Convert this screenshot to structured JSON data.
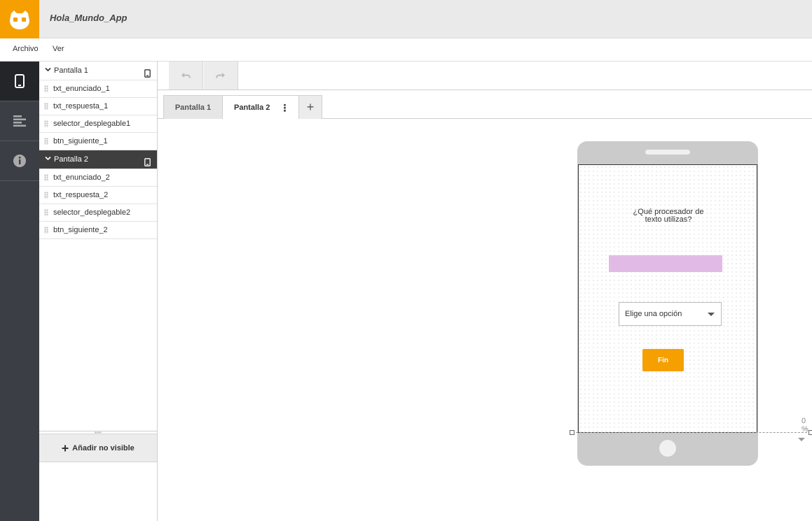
{
  "app": {
    "title": "Hola_Mundo_App",
    "logo_icon": "owl-face-icon",
    "accent_color": "#f5a000"
  },
  "menu": {
    "items": [
      "Archivo",
      "Ver"
    ]
  },
  "rail": {
    "items": [
      {
        "icon": "phone-icon",
        "active": true
      },
      {
        "icon": "align-left-icon",
        "active": false
      },
      {
        "icon": "info-icon",
        "active": false
      }
    ]
  },
  "tree": {
    "screens": [
      {
        "label": "Pantalla 1",
        "selected": false,
        "children": [
          "txt_enunciado_1",
          "txt_respuesta_1",
          "selector_desplegable1",
          "btn_siguiente_1"
        ]
      },
      {
        "label": "Pantalla 2",
        "selected": true,
        "children": [
          "txt_enunciado_2",
          "txt_respuesta_2",
          "selector_desplegable2",
          "btn_siguiente_2"
        ]
      }
    ],
    "add_invisible_label": "Añadir no visible"
  },
  "toolbar": {
    "undo_icon": "undo-icon",
    "redo_icon": "redo-icon"
  },
  "tabs": {
    "items": [
      {
        "label": "Pantalla 1",
        "active": false
      },
      {
        "label": "Pantalla 2",
        "active": true
      }
    ],
    "add_label": "+"
  },
  "preview": {
    "question_line1": "¿Qué procesador de",
    "question_line2": "texto utilizas?",
    "answer_box_color": "#e1bbe5",
    "select_value": "Elige una opción",
    "button_label": "Fin",
    "zoom_label": "0 %"
  }
}
